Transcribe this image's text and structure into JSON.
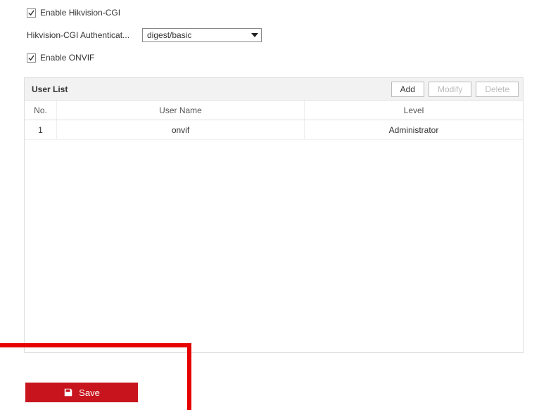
{
  "form": {
    "enable_cgi_label": "Enable Hikvision-CGI",
    "auth_label": "Hikvision-CGI Authenticat...",
    "auth_value": "digest/basic",
    "enable_onvif_label": "Enable ONVIF"
  },
  "userlist": {
    "title": "User List",
    "add_label": "Add",
    "modify_label": "Modify",
    "delete_label": "Delete",
    "columns": {
      "no": "No.",
      "user": "User Name",
      "level": "Level"
    },
    "rows": [
      {
        "no": "1",
        "user": "onvif",
        "level": "Administrator"
      }
    ]
  },
  "save_label": "Save"
}
